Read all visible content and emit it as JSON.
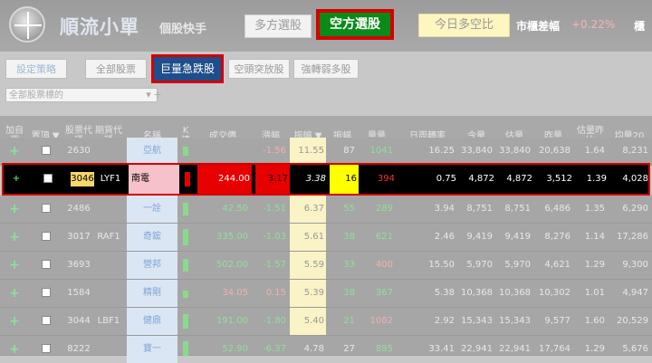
{
  "header": {
    "logo_text": "順流小單",
    "logo_sub": "個股快手",
    "btn_long": "多方選股",
    "btn_short": "空方選股",
    "btn_ratio": "今日多空比",
    "spread_label": "市櫃差幅",
    "spread_value": "+0.22%",
    "more_label": "櫃"
  },
  "tabs": {
    "strategy": "設定策略",
    "all": "全部股票",
    "active": "巨量急跌股",
    "short_release": "空頭突放股",
    "strong_weak": "強轉弱多股"
  },
  "filter": {
    "placeholder": "全部股票標的",
    "btn1": "▾",
    "btn2": "+"
  },
  "columns": [
    "加自選",
    "置頂 ▼",
    "股票代碼",
    "期貨代碼",
    "名稱",
    "K棒",
    "成交價",
    "漲幅",
    "振幅 ▼",
    "振幅",
    "量量",
    "日周轉率",
    "今量",
    "估量",
    "昨量",
    "估量昨比",
    "均量20"
  ],
  "rows": [
    {
      "add": "+",
      "code": "2630",
      "fut": "",
      "name": "亞航",
      "price": "",
      "chg": "-1.56",
      "amp": "11.55",
      "amp2": "87",
      "vol": "1041",
      "turn": "16.25",
      "today": "33,840",
      "est": "33,840",
      "yest": "20,638",
      "ratio": "1.64",
      "avg20": "8,231"
    },
    {
      "add": "+",
      "code": "3046",
      "fut": "LYF1",
      "name": "南電",
      "price": "244.00",
      "chg": "3.17",
      "amp": "3.38",
      "amp2": "16",
      "vol": "394",
      "turn": "0.75",
      "today": "4,872",
      "est": "4,872",
      "yest": "3,512",
      "ratio": "1.39",
      "avg20": "4,028"
    },
    {
      "add": "+",
      "code": "2486",
      "fut": "",
      "name": "一詮",
      "price": "42.50",
      "chg": "-1.51",
      "amp": "6.37",
      "amp2": "55",
      "vol": "289",
      "turn": "3.94",
      "today": "8,751",
      "est": "8,751",
      "yest": "6,486",
      "ratio": "1.35",
      "avg20": "6,290"
    },
    {
      "add": "+",
      "code": "3017",
      "fut": "RAF1",
      "name": "奇鋐",
      "price": "335.00",
      "chg": "-1.03",
      "amp": "5.61",
      "amp2": "38",
      "vol": "621",
      "turn": "2.46",
      "today": "9,419",
      "est": "9,419",
      "yest": "8,276",
      "ratio": "1.14",
      "avg20": "17,286"
    },
    {
      "add": "+",
      "code": "3693",
      "fut": "",
      "name": "營邦",
      "price": "502.00",
      "chg": "-1.57",
      "amp": "5.59",
      "amp2": "33",
      "vol": "400",
      "turn": "15.50",
      "today": "5,970",
      "est": "5,970",
      "yest": "4,621",
      "ratio": "1.29",
      "avg20": "9,300"
    },
    {
      "add": "+",
      "code": "1584",
      "fut": "",
      "name": "精剛",
      "price": "34.05",
      "chg": "0.15",
      "amp": "5.39",
      "amp2": "38",
      "vol": "367",
      "turn": "5.38",
      "today": "10,368",
      "est": "10,368",
      "yest": "10,302",
      "ratio": "1.01",
      "avg20": "4,947"
    },
    {
      "add": "+",
      "code": "3044",
      "fut": "LBF1",
      "name": "健鼎",
      "price": "191.00",
      "chg": "-1.80",
      "amp": "5.40",
      "amp2": "21",
      "vol": "1082",
      "turn": "2.92",
      "today": "15,343",
      "est": "15,343",
      "yest": "9,577",
      "ratio": "1.60",
      "avg20": "20,529"
    },
    {
      "add": "+",
      "code": "8222",
      "fut": "",
      "name": "寶一",
      "price": "52.90",
      "chg": "-6.37",
      "amp": "4.78",
      "amp2": "27",
      "vol": "895",
      "turn": "33.41",
      "today": "22,941",
      "est": "22,941",
      "yest": "17,764",
      "ratio": "1.29",
      "avg20": "5,676"
    }
  ]
}
